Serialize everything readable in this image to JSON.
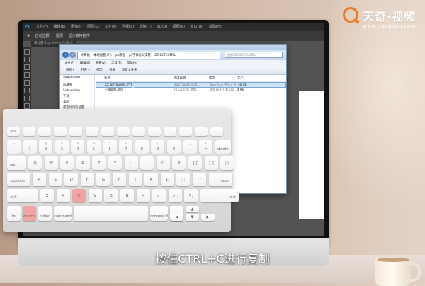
{
  "brand": {
    "name": "天奇·视频",
    "url": "www.tianqijun.com"
  },
  "caption": "按住CTRL+C进行复制",
  "photoshop": {
    "logo": "Ps",
    "menu": [
      "文件(F)",
      "编辑(E)",
      "图像(I)",
      "图层(L)",
      "文字(Y)",
      "选择(S)",
      "滤镜(T)",
      "3D(D)",
      "视图(V)",
      "窗口(W)",
      "帮助(H)"
    ],
    "options": [
      "自动选择:",
      "图层",
      "显示变换控件"
    ],
    "doc_tab": "未标题-1 @ 100%(RGB/8)"
  },
  "explorer": {
    "breadcrumb": [
      "计算机",
      "本地磁盘 (F:)",
      "ps教程",
      "ps字体怎么安装",
      "ZZ BETSUMEL"
    ],
    "search_placeholder": "搜索 ZZ BETSUMEL",
    "menu": [
      "文件(F)",
      "编辑(E)",
      "查看(V)",
      "工具(T)",
      "帮助(H)"
    ],
    "commands": [
      "组织 ▾",
      "打开 ▾",
      "打印",
      "刻录",
      "新建文件夹"
    ],
    "nav": [
      "收藏夹",
      "Subversion",
      "下载",
      "桌面",
      "最近访问的位置"
    ],
    "nav_top": "Subversion",
    "columns": [
      "名称",
      "修改日期",
      "类型",
      "大小"
    ],
    "files": [
      {
        "name": "ZZ BETSUMEL.TTF",
        "date": "2017/6/28 星期...",
        "type": "TrueType 字体文件",
        "size": "36 KB",
        "selected": true
      },
      {
        "name": "下载说明.htm",
        "date": "2012/3/18 星期...",
        "type": "360 se HTML Do...",
        "size": "4 KB",
        "selected": false
      }
    ]
  },
  "keyboard": {
    "highlight_color": "#f0a4a4",
    "rows": {
      "fn": [
        "esc",
        "",
        "",
        "",
        "",
        "",
        "",
        "",
        "",
        "",
        "",
        "",
        "",
        ""
      ],
      "num": [
        {
          "t": "~",
          "b": "`"
        },
        {
          "t": "!",
          "b": "1"
        },
        {
          "t": "@",
          "b": "2"
        },
        {
          "t": "#",
          "b": "3"
        },
        {
          "t": "$",
          "b": "4"
        },
        {
          "t": "%",
          "b": "5"
        },
        {
          "t": "^",
          "b": "6"
        },
        {
          "t": "&",
          "b": "7"
        },
        {
          "t": "*",
          "b": "8"
        },
        {
          "t": "(",
          "b": "9"
        },
        {
          "t": ")",
          "b": "0"
        },
        {
          "t": "_",
          "b": "-"
        },
        {
          "t": "+",
          "b": "="
        },
        {
          "t": "",
          "b": "delete"
        }
      ],
      "q": [
        "tab",
        "Q",
        "W",
        "E",
        "R",
        "T",
        "Y",
        "U",
        "I",
        "O",
        "P",
        "{ [",
        "} ]",
        "| \\"
      ],
      "a": [
        "caps lock",
        "A",
        "S",
        "D",
        "F",
        "G",
        "H",
        "J",
        "K",
        "L",
        ": ;",
        "\" '",
        "return"
      ],
      "z": [
        "shift",
        "Z",
        "X",
        "C",
        "V",
        "B",
        "N",
        "M",
        "< ,",
        "> .",
        "? /",
        "shift"
      ],
      "bottom": [
        "fn",
        "control",
        "option",
        "command",
        "",
        "command",
        "option"
      ]
    }
  }
}
